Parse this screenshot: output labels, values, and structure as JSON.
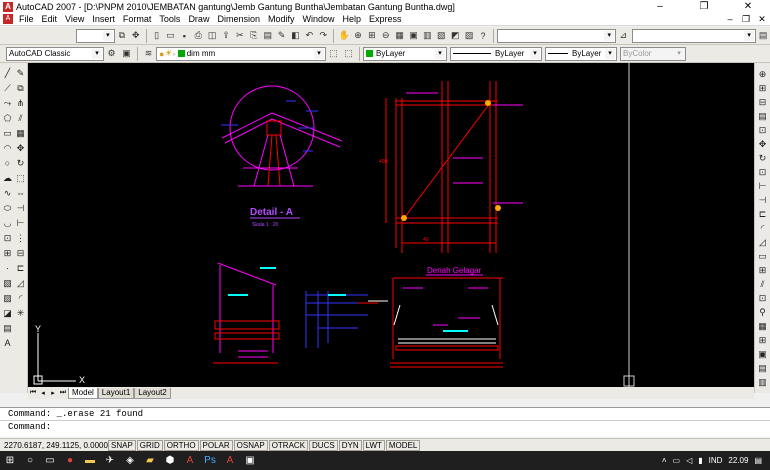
{
  "window": {
    "title": "AutoCAD 2007 - [D:\\PNPM 2010\\JEMBATAN gantung\\Jemb Gantung Buntha\\Jembatan Gantung Buntha.dwg]",
    "minimize": "–",
    "maximize": "❐",
    "close": "✕"
  },
  "menu": [
    "File",
    "Edit",
    "View",
    "Insert",
    "Format",
    "Tools",
    "Draw",
    "Dimension",
    "Modify",
    "Window",
    "Help",
    "Express"
  ],
  "toolbar1": {
    "named_view": "",
    "workspace": "AutoCAD Classic"
  },
  "toolbar2": {
    "layer": "dim mm",
    "color": "ByLayer",
    "linetype": "ByLayer",
    "lineweight": "ByLayer",
    "plotstyle": "ByColor"
  },
  "drawing": {
    "detail_title": "Detail - A",
    "detail_scale": "Skala 1 : 20",
    "plan_title": "Denah Gelagar",
    "ucs_x": "X",
    "ucs_y": "Y",
    "dim_400": "400",
    "dim_40": "40"
  },
  "tabs": {
    "model": "Model",
    "layout1": "Layout1",
    "layout2": "Layout2"
  },
  "command": {
    "line1": "Command:  _.erase 21 found",
    "line2": "Command:"
  },
  "status": {
    "coords": "2270.6187, 249.1125, 0.0000",
    "buttons": [
      "SNAP",
      "GRID",
      "ORTHO",
      "POLAR",
      "OSNAP",
      "OTRACK",
      "DUCS",
      "DYN",
      "LWT",
      "MODEL"
    ]
  },
  "taskbar": {
    "lang": "IND",
    "time": "22.09"
  },
  "colors": {
    "canvas": "#000000",
    "red": "#ff0000",
    "magenta": "#ff00ff",
    "cyan": "#00ffff",
    "blue": "#3333ff",
    "white": "#ffffff"
  }
}
